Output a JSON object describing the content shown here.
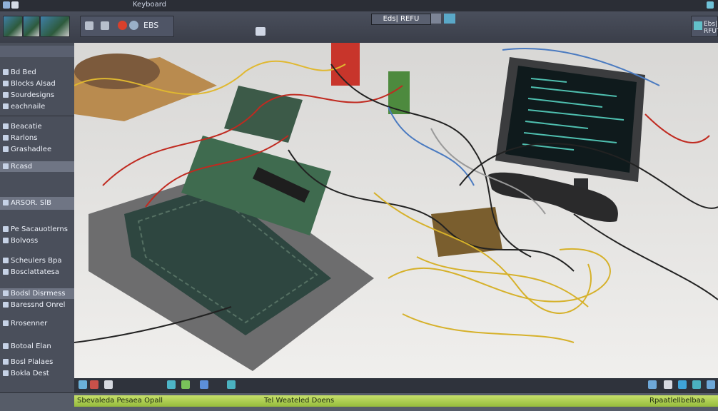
{
  "title_bar": {
    "title": "Keyboard"
  },
  "toolbar": {
    "labels": [
      "EBS",
      "Ebs| RFUT"
    ],
    "center_title": "Eds| REFU"
  },
  "left_panel": {
    "items": [
      "Bd Bed",
      "Blocks Alsad",
      "Sourdesigns",
      "eachnaile",
      "Beacatie",
      "Rarlons",
      "Grashadlee",
      "Rcasd",
      "ARSOR. SlB",
      "Pe Sacauotlerns",
      "Bolvoss",
      "Scheulers Bpa",
      "Bosclattatesa",
      "Bodsl Disrmess",
      "Baressnd Onrel",
      "Rrosenner",
      "Botoal Elan",
      "Bosl Plalaes",
      "Bokla Dest"
    ]
  },
  "status_bar": {
    "left_text": "Sbevaleda Pesaea Opall",
    "center_text": "Tel Weateled Doens",
    "right_text": "Rpaatlellbelbaa"
  },
  "colors": {
    "accent": "#95bb3c",
    "panel": "#4a4f5b"
  }
}
